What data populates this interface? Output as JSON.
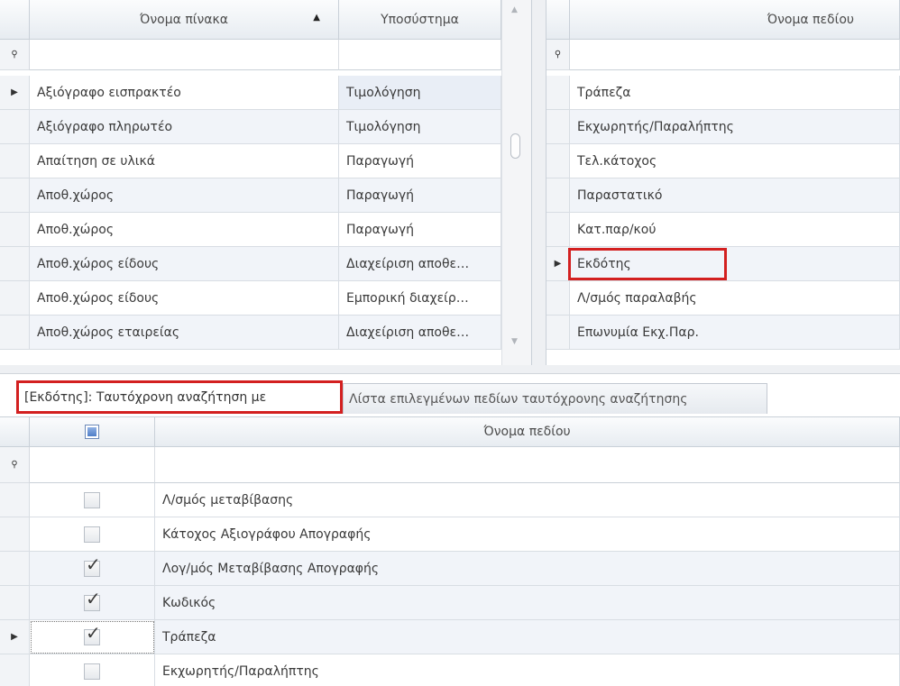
{
  "left_grid": {
    "columns": {
      "table_name": "Όνομα πίνακα",
      "subsystem": "Υποσύστημα"
    },
    "rows": [
      {
        "name": "Αξιόγραφο εισπρακτέο",
        "subsystem": "Τιμολόγηση"
      },
      {
        "name": "Αξιόγραφο πληρωτέο",
        "subsystem": "Τιμολόγηση"
      },
      {
        "name": "Απαίτηση σε υλικά",
        "subsystem": "Παραγωγή"
      },
      {
        "name": "Αποθ.χώρος",
        "subsystem": "Παραγωγή"
      },
      {
        "name": "Αποθ.χώρος",
        "subsystem": "Παραγωγή"
      },
      {
        "name": "Αποθ.χώρος είδους",
        "subsystem": "Διαχείριση αποθε…"
      },
      {
        "name": "Αποθ.χώρος είδους",
        "subsystem": "Εμπορική διαχείρ…"
      },
      {
        "name": "Αποθ.χώρος εταιρείας",
        "subsystem": "Διαχείριση αποθε…"
      }
    ]
  },
  "right_grid": {
    "column": "Όνομα πεδίου",
    "rows": [
      "Τράπεζα",
      "Εκχωρητής/Παραλήπτης",
      "Τελ.κάτοχος",
      "Παραστατικό",
      "Κατ.παρ/κού",
      "Εκδότης",
      "Λ/σμός παραλαβής",
      "Επωνυμία Εκχ.Παρ."
    ],
    "selected_index": 5
  },
  "tabs": {
    "active": "[Εκδότης]: Ταυτόχρονη αναζήτηση με",
    "inactive": "Λίστα επιλεγμένων πεδίων ταυτόχρονης αναζήτησης"
  },
  "bottom_grid": {
    "column": "Όνομα πεδίου",
    "rows": [
      {
        "label": "Λ/σμός μεταβίβασης",
        "checked": false
      },
      {
        "label": "Κάτοχος Αξιογράφου Απογραφής",
        "checked": false
      },
      {
        "label": "Λογ/μός Μεταβίβασης Απογραφής",
        "checked": true
      },
      {
        "label": "Κωδικός",
        "checked": true
      },
      {
        "label": "Τράπεζα",
        "checked": true
      },
      {
        "label": "Εκχωρητής/Παραλήπτης",
        "checked": false
      }
    ]
  },
  "icons": {
    "filter": "filter-icon",
    "row_indicator": "row-indicator-icon",
    "sort": "sort-ascending-icon"
  },
  "colors": {
    "highlight_border": "#d32020",
    "alt_row": "#f1f4f9",
    "header": "#e7ecf1"
  }
}
